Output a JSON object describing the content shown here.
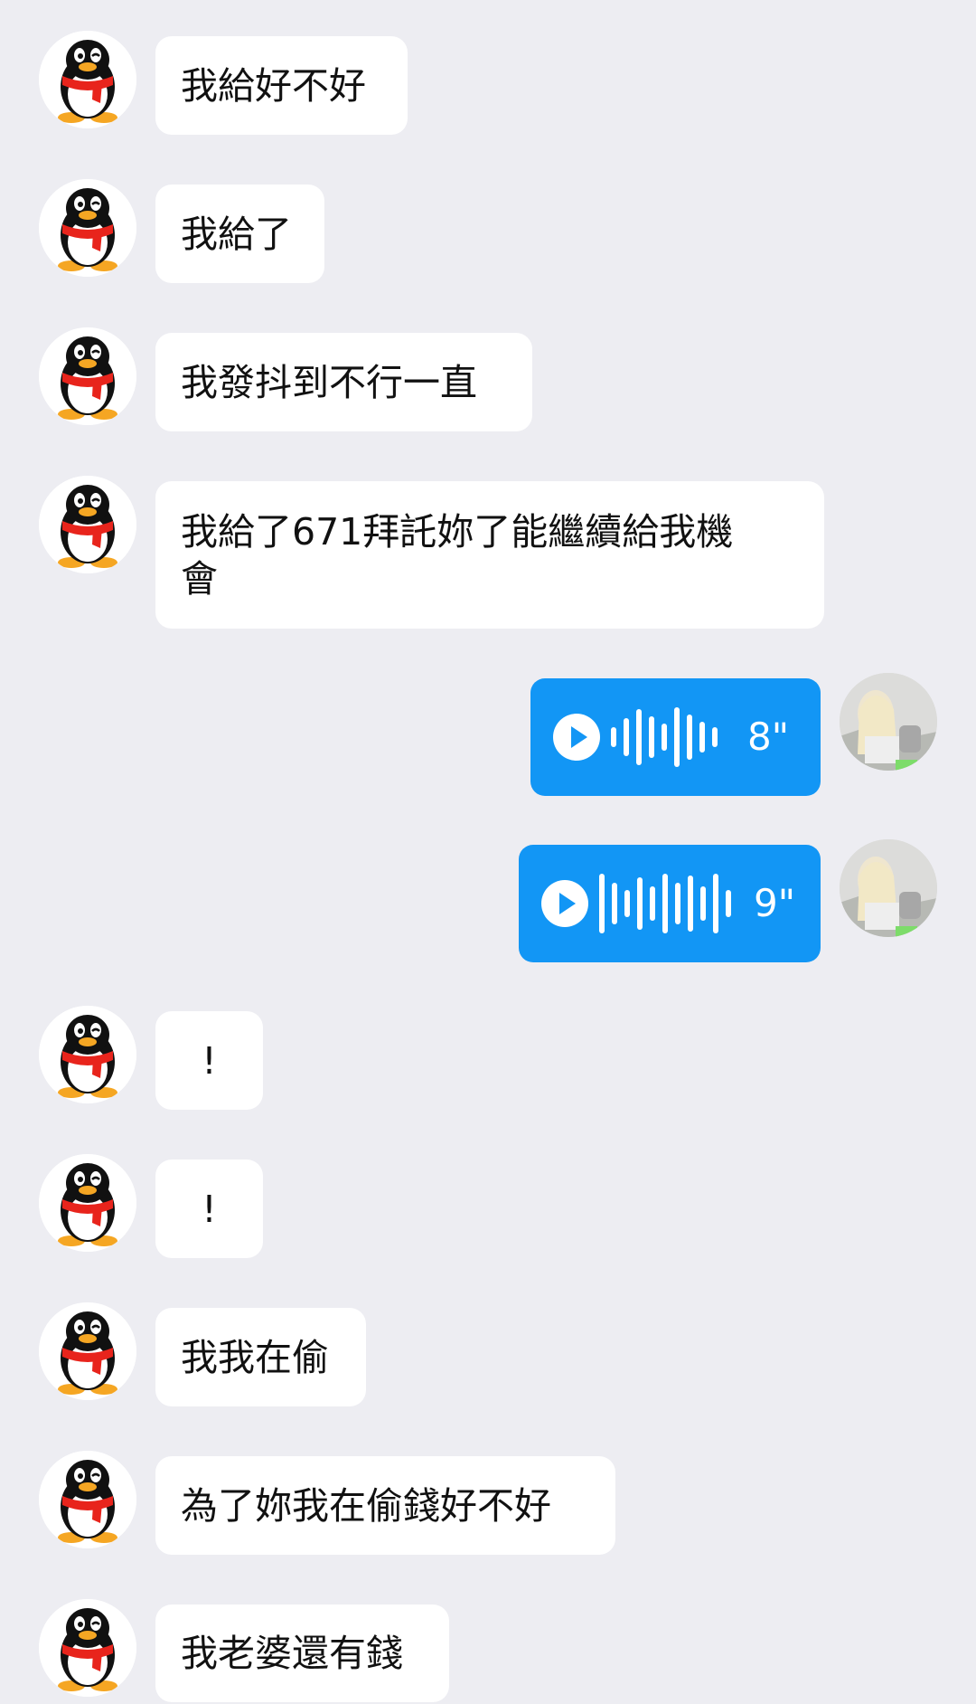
{
  "colors": {
    "background": "#ededf2",
    "bubble": "#ffffff",
    "voice_bubble": "#1296f5"
  },
  "avatar_icon": "qq-penguin-avatar",
  "messages": [
    {
      "side": "left",
      "text": "我給好不好"
    },
    {
      "side": "left",
      "text": "我給了"
    },
    {
      "side": "left",
      "text": "我發抖到不行一直"
    },
    {
      "side": "left",
      "text": "我給了671拜託妳了能繼續給我機\n會"
    },
    {
      "side": "right",
      "type": "voice",
      "duration": "8\""
    },
    {
      "side": "right",
      "type": "voice",
      "duration": "9\""
    },
    {
      "side": "left",
      "text": "!"
    },
    {
      "side": "left",
      "text": "!"
    },
    {
      "side": "left",
      "text": "我我在偷"
    },
    {
      "side": "left",
      "text": "為了妳我在偷錢好不好"
    },
    {
      "side": "left",
      "text": "我老婆還有錢"
    }
  ]
}
